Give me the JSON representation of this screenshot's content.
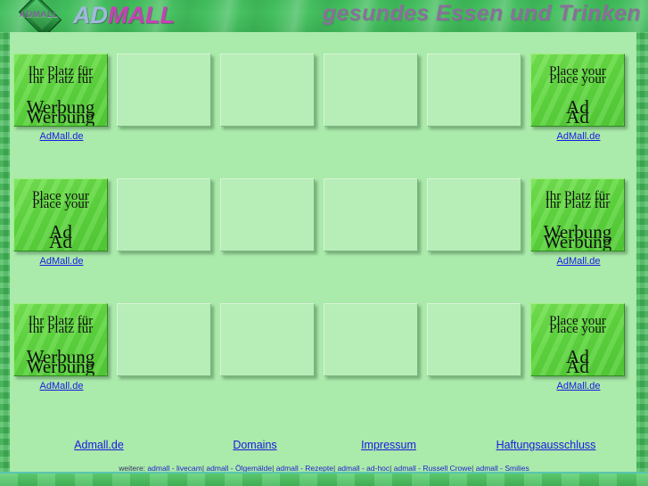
{
  "header": {
    "logo_diamond_text": "ADMALL",
    "logo_word_ad": "AD",
    "logo_word_mall": "MALL",
    "tagline": "gesundes Essen und Trinken",
    "banner_color": "#3fba5a",
    "tagline_color": "#8a6f9a",
    "logo_mall_color": "#c93fb8"
  },
  "page": {
    "background_color": "#aaeaaa",
    "border_color": "#47b85c",
    "link_color": "#1a1ae0"
  },
  "ad_grid": {
    "rows": [
      {
        "cells": [
          {
            "type": "filled",
            "line1": "Ihr Platz für",
            "line2": "Werbung",
            "link": "AdMall.de"
          },
          {
            "type": "empty"
          },
          {
            "type": "empty"
          },
          {
            "type": "empty"
          },
          {
            "type": "empty"
          },
          {
            "type": "filled",
            "line1": "Place your",
            "line2": "Ad",
            "link": "AdMall.de"
          }
        ]
      },
      {
        "cells": [
          {
            "type": "filled",
            "line1": "Place your",
            "line2": "Ad",
            "link": "AdMall.de"
          },
          {
            "type": "empty"
          },
          {
            "type": "empty"
          },
          {
            "type": "empty"
          },
          {
            "type": "empty"
          },
          {
            "type": "filled",
            "line1": "Ihr Platz für",
            "line2": "Werbung",
            "link": "AdMall.de"
          }
        ]
      },
      {
        "cells": [
          {
            "type": "filled",
            "line1": "Ihr Platz für",
            "line2": "Werbung",
            "link": "AdMall.de"
          },
          {
            "type": "empty"
          },
          {
            "type": "empty"
          },
          {
            "type": "empty"
          },
          {
            "type": "empty"
          },
          {
            "type": "filled",
            "line1": "Place your",
            "line2": "Ad",
            "link": "AdMall.de"
          }
        ]
      }
    ]
  },
  "footer": {
    "links": [
      {
        "label": "Admall.de"
      },
      {
        "label": "Domains"
      },
      {
        "label": "Impressum"
      },
      {
        "label": "Haftungsausschluss"
      }
    ],
    "more_label": "weitere:",
    "more_links": [
      "admall - livecam",
      "admall - Ölgemälde",
      "admall - Rezepte",
      "admall - ad-hoc",
      "admall - Russell Crowe",
      "admall - Smilies"
    ],
    "separator": "|"
  }
}
